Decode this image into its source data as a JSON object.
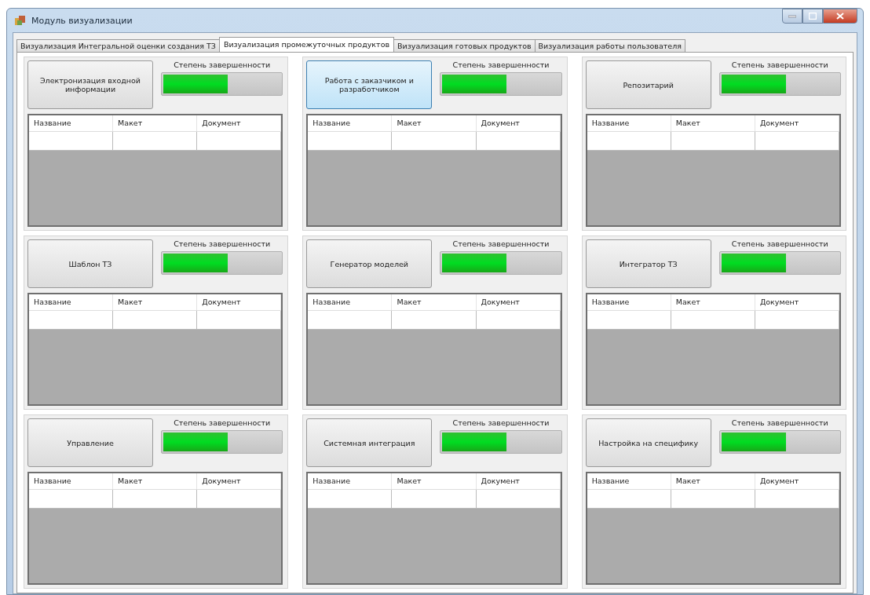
{
  "window": {
    "title": "Модуль визуализации"
  },
  "tabs": [
    {
      "label": "Визуализация Интегральной оценки создания ТЗ",
      "selected": false
    },
    {
      "label": "Визуализация промежуточных продуктов",
      "selected": true
    },
    {
      "label": "Визуализация готовых продуктов",
      "selected": false
    },
    {
      "label": "Визуализация работы пользователя",
      "selected": false
    }
  ],
  "panels": [
    {
      "button": "Электронизация входной информации",
      "highlighted": false,
      "progress_label": "Степень завершенности",
      "level": 0.55,
      "columns": [
        "Название",
        "Макет",
        "Документ"
      ]
    },
    {
      "button": "Работа с заказчиком и разработчиком",
      "highlighted": true,
      "progress_label": "Степень завершенности",
      "level": 0.55,
      "columns": [
        "Название",
        "Макет",
        "Документ"
      ]
    },
    {
      "button": "Репозитарий",
      "highlighted": false,
      "progress_label": "Степень завершенности",
      "level": 0.55,
      "columns": [
        "Название",
        "Макет",
        "Документ"
      ]
    },
    {
      "button": "Шаблон ТЗ",
      "highlighted": false,
      "progress_label": "Степень завершенности",
      "level": 0.55,
      "columns": [
        "Название",
        "Макет",
        "Документ"
      ]
    },
    {
      "button": "Генератор моделей",
      "highlighted": false,
      "progress_label": "Степень завершенности",
      "level": 0.55,
      "columns": [
        "Название",
        "Макет",
        "Документ"
      ]
    },
    {
      "button": "Интегратор ТЗ",
      "highlighted": false,
      "progress_label": "Степень завершенности",
      "level": 0.55,
      "columns": [
        "Название",
        "Макет",
        "Документ"
      ]
    },
    {
      "button": "Управление",
      "highlighted": false,
      "progress_label": "Степень завершенности",
      "level": 0.55,
      "columns": [
        "Название",
        "Макет",
        "Документ"
      ]
    },
    {
      "button": "Системная интеграция",
      "highlighted": false,
      "progress_label": "Степень завершенности",
      "level": 0.55,
      "columns": [
        "Название",
        "Макет",
        "Документ"
      ]
    },
    {
      "button": "Настройка на специфику",
      "highlighted": false,
      "progress_label": "Степень завершенности",
      "level": 0.55,
      "columns": [
        "Название",
        "Макет",
        "Документ"
      ]
    }
  ]
}
